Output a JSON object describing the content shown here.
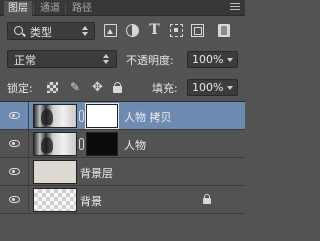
{
  "tabs": [
    {
      "label": "图层",
      "active": true
    },
    {
      "label": "通道",
      "active": false
    },
    {
      "label": "路径",
      "active": false
    }
  ],
  "filter": {
    "kind_label": "类型",
    "icons": [
      "image-filter-icon",
      "adjustment-filter-icon",
      "type-filter-icon",
      "shape-filter-icon",
      "smart-object-filter-icon"
    ]
  },
  "blend": {
    "mode": "正常",
    "opacity_label": "不透明度:",
    "opacity_value": "100%"
  },
  "lock": {
    "label": "锁定:",
    "fill_label": "填充:",
    "fill_value": "100%"
  },
  "layers": [
    {
      "name": "人物 拷贝",
      "selected": true,
      "thumb": "photo",
      "mask": "white"
    },
    {
      "name": "人物",
      "selected": false,
      "thumb": "photo",
      "mask": "black"
    },
    {
      "name": "背景层",
      "selected": false,
      "thumb": "bg",
      "mask": null
    },
    {
      "name": "背景",
      "selected": false,
      "thumb": "checker",
      "mask": null,
      "locked": true
    }
  ],
  "colors": {
    "panel_bg": "#535353",
    "selected_row": "#6d8ab0",
    "tab_bar": "#383838"
  }
}
